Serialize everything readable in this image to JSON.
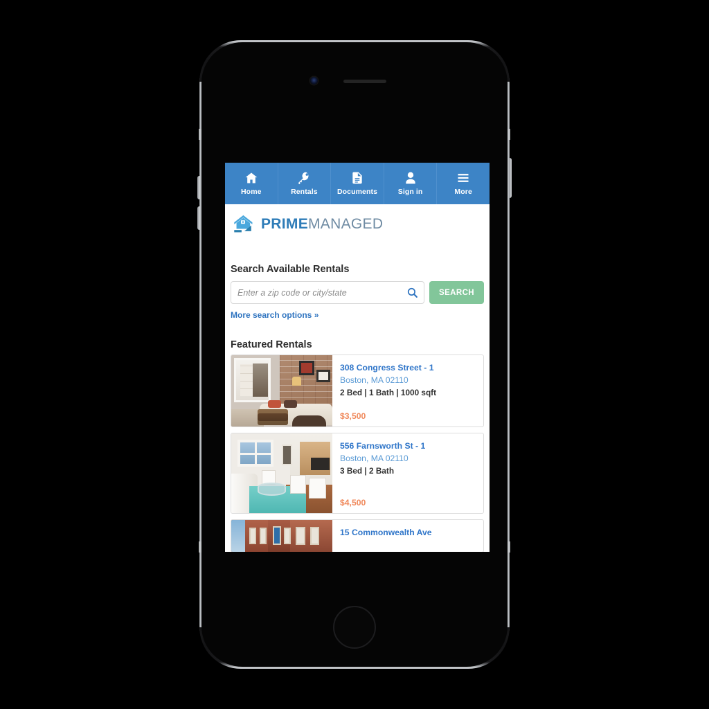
{
  "device": {
    "type": "smartphone",
    "camera": "front-camera",
    "speaker": "earpiece-speaker",
    "home": "home-button"
  },
  "nav": {
    "items": [
      {
        "label": "Home",
        "icon": "house-icon"
      },
      {
        "label": "Rentals",
        "icon": "key-icon"
      },
      {
        "label": "Documents",
        "icon": "document-icon"
      },
      {
        "label": "Sign in",
        "icon": "person-icon"
      },
      {
        "label": "More",
        "icon": "hamburger-icon"
      }
    ],
    "background_color": "#3d84c6",
    "text_color": "#ffffff"
  },
  "logo": {
    "icon": "house-logo-icon",
    "word_bold": "PRIME",
    "word_light": "MANAGED",
    "bold_color": "#2e7cb8",
    "light_color": "#6f8ba3"
  },
  "search": {
    "title": "Search Available Rentals",
    "placeholder": "Enter a zip code or city/state",
    "value": "",
    "magnifier_icon": "search-icon",
    "button_label": "SEARCH",
    "button_color": "#82c69a",
    "more_options_label": "More search options »",
    "link_color": "#2f74c0"
  },
  "featured": {
    "title": "Featured Rentals",
    "price_color": "#f08a5d",
    "address_color": "#3076c9",
    "city_color": "#5b9bd5",
    "listings": [
      {
        "address": "308 Congress Street - 1",
        "city": "Boston, MA 02110",
        "details": "2 Bed | 1 Bath | 1000 sqft",
        "price": "$3,500",
        "photo": "living-room-brick-wall"
      },
      {
        "address": "556 Farnsworth St - 1",
        "city": "Boston, MA 02110",
        "details": "3 Bed | 2 Bath",
        "price": "$4,500",
        "photo": "modern-living-room-teal-rug"
      },
      {
        "address": "15 Commonwealth Ave",
        "city": "",
        "details": "",
        "price": "",
        "photo": "brownstone-exterior"
      }
    ]
  }
}
